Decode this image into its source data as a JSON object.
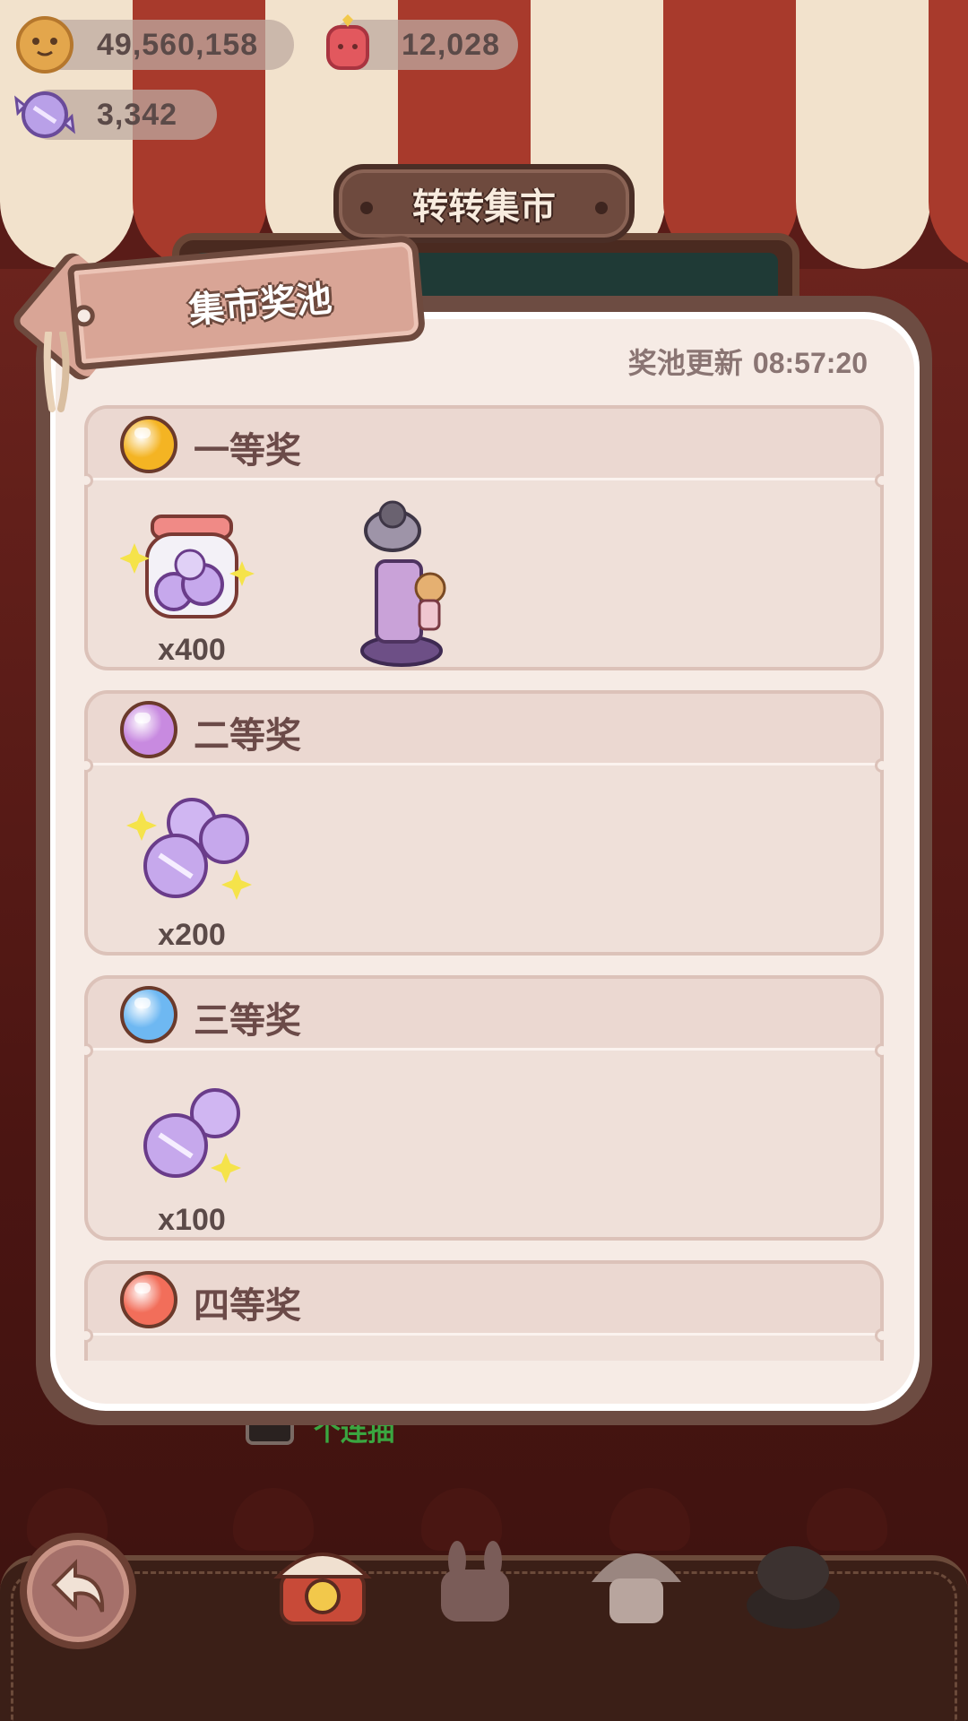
{
  "currencies": [
    {
      "name": "cookie",
      "value": "49,560,158"
    },
    {
      "name": "red-potion",
      "value": "12,028"
    },
    {
      "name": "candy",
      "value": "3,342"
    }
  ],
  "market": {
    "title": "转转集市"
  },
  "background_hint": {
    "text": "个连抽"
  },
  "modal": {
    "tag_title": "集市奖池",
    "refresh_label": "奖池更新",
    "refresh_time": "08:57:20",
    "prizes": [
      {
        "name": "一等奖",
        "orb_color": "#f4b423",
        "rewards": [
          {
            "icon": "candy-jar-icon",
            "qty": "x400"
          },
          {
            "icon": "cat-tree-icon",
            "qty": ""
          }
        ]
      },
      {
        "name": "二等奖",
        "orb_color": "#c88ae0",
        "rewards": [
          {
            "icon": "candy-pile-icon",
            "qty": "x200"
          }
        ]
      },
      {
        "name": "三等奖",
        "orb_color": "#6eb8f2",
        "rewards": [
          {
            "icon": "candy-pair-icon",
            "qty": "x100"
          }
        ]
      },
      {
        "name": "四等奖",
        "orb_color": "#f26e5a",
        "rewards": []
      }
    ]
  },
  "colors": {
    "accent_brown": "#6e4a3e",
    "panel": "#f6ebe5",
    "tag": "#d9a596"
  }
}
